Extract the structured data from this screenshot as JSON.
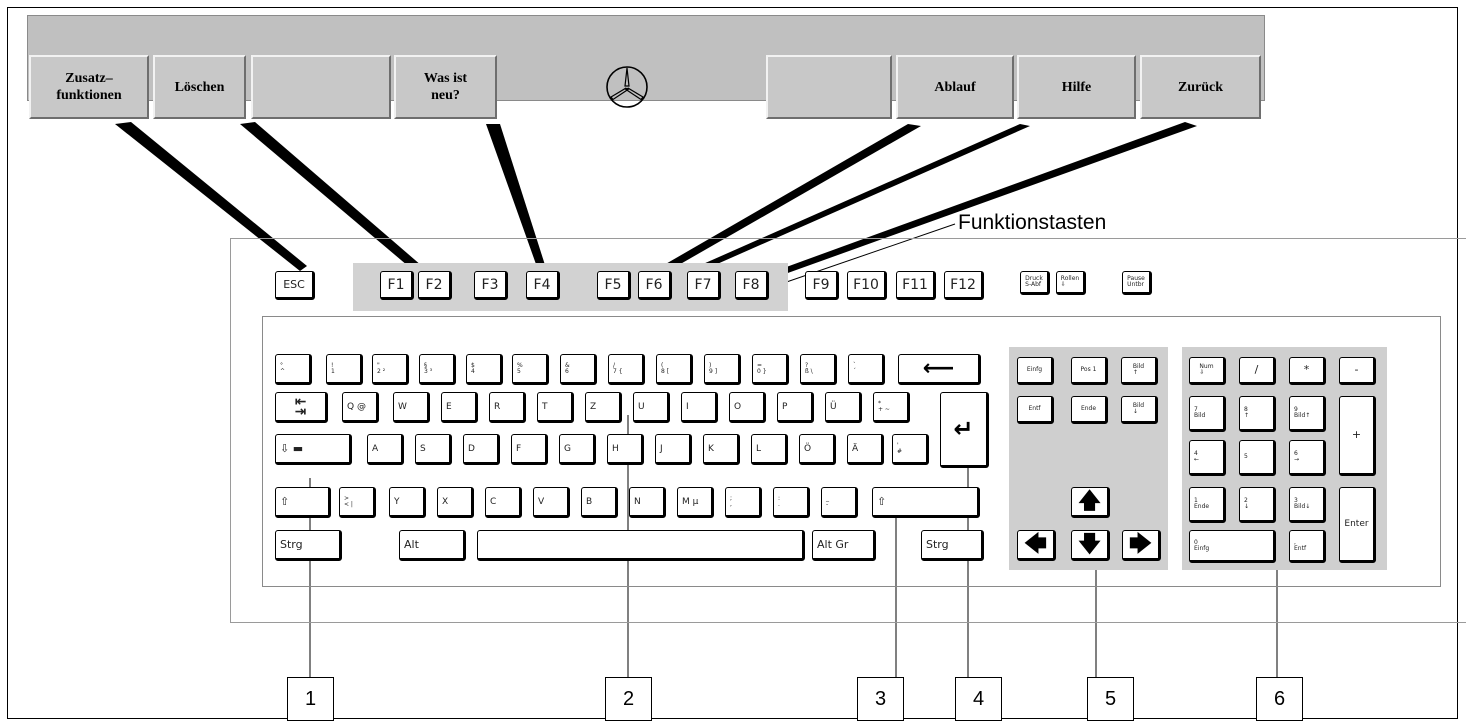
{
  "toolbar": {
    "buttons": [
      {
        "id": "zusatzfunktionen",
        "label": "Zusatz–\nfunktionen"
      },
      {
        "id": "loeschen",
        "label": "Löschen"
      },
      {
        "id": "empty-1",
        "label": ""
      },
      {
        "id": "was-ist-neu",
        "label": "Was ist\nneu?"
      },
      {
        "id": "empty-2",
        "label": ""
      },
      {
        "id": "ablauf",
        "label": "Ablauf"
      },
      {
        "id": "hilfe",
        "label": "Hilfe"
      },
      {
        "id": "zurueck",
        "label": "Zurück"
      }
    ],
    "logo_icon": "mercedes-star-icon"
  },
  "keyboard": {
    "function_keys_label": "Funktionstasten",
    "esc": "ESC",
    "fkeys": [
      "F1",
      "F2",
      "F3",
      "F4",
      "F5",
      "F6",
      "F7",
      "F8",
      "F9",
      "F10",
      "F11",
      "F12"
    ],
    "special_keys": [
      "Druck\nS-Abf",
      "Rollen\n⇩",
      "Pause\nUntbr"
    ],
    "row1": [
      "°\n^",
      "!\n1",
      "\"\n2 ²",
      "§\n3 ³",
      "$\n4",
      "%\n5",
      "&\n6",
      "/\n7 {",
      "(\n8 [",
      ")\n9 ]",
      "=\n0 }",
      "?\nß \\",
      "`\n´"
    ],
    "row2_letters": [
      "Q @",
      "W",
      "E",
      "R",
      "T",
      "Z",
      "U",
      "I",
      "O",
      "P",
      "Ü",
      "*\n+ ~"
    ],
    "row3_letters": [
      "A",
      "S",
      "D",
      "F",
      "G",
      "H",
      "J",
      "K",
      "L",
      "Ö",
      "Ä",
      "'\n#"
    ],
    "row4_letters": [
      ">\n< |",
      "Y",
      "X",
      "C",
      "V",
      "B",
      "N",
      "M µ",
      ";\n,",
      ":\n.",
      "_\n-"
    ],
    "alt": "Alt",
    "altgr": "Alt Gr",
    "strg": "Strg",
    "nav": [
      "Einfg",
      "Pos 1",
      "Bild\n↑",
      "Entf",
      "Ende",
      "Bild\n↓"
    ],
    "numpad": {
      "num": "Num\n⇩",
      "div": "/",
      "mul": "*",
      "minus": "-",
      "plus": "+",
      "enter": "Enter",
      "k7": "7\nBild",
      "k8": "8\n↑",
      "k9": "9\nBild↑",
      "k4": "4\n←",
      "k5": "5",
      "k6": "6\n→",
      "k1": "1\nEnde",
      "k2": "2\n↓",
      "k3": "3\nBild↓",
      "k0": "0\nEinfg",
      "kdot": ",\nEntf"
    }
  },
  "callouts": [
    "1",
    "2",
    "3",
    "4",
    "5",
    "6"
  ],
  "colors": {
    "panel": "#c0c0c0",
    "button": "#c8c8c8",
    "key_area": "#cfcfcf"
  }
}
